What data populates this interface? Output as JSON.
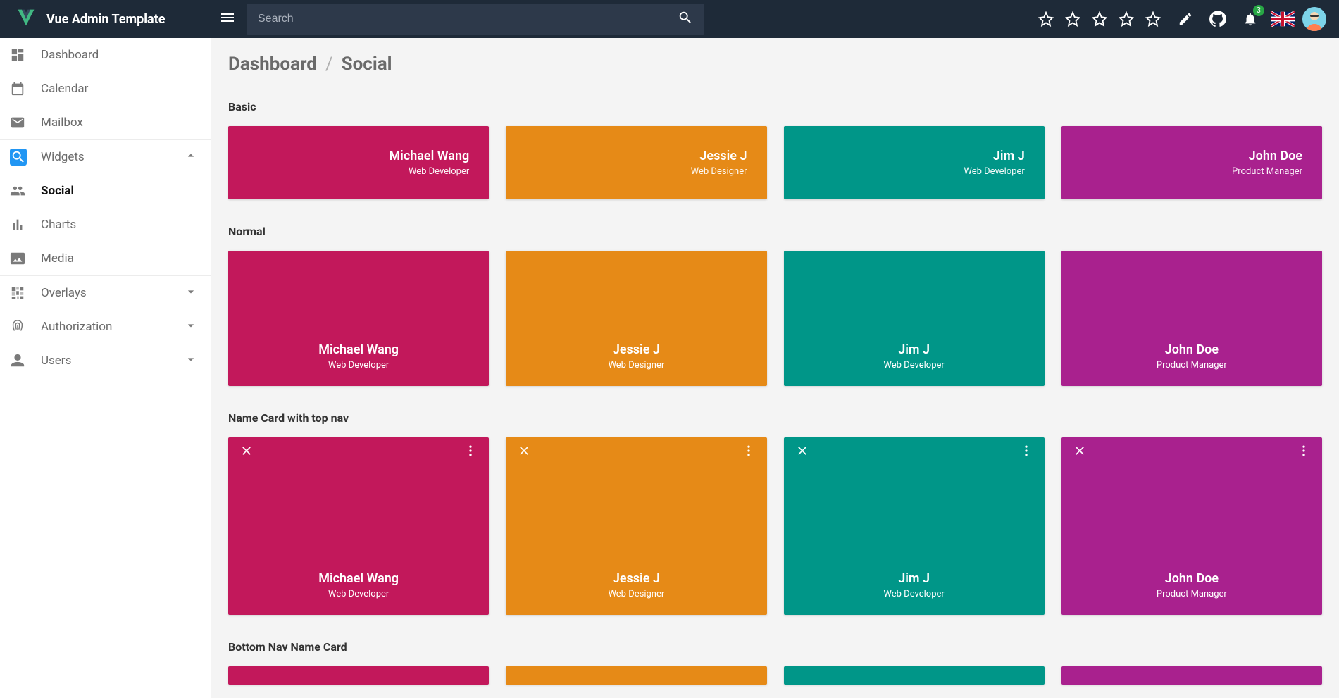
{
  "brand": {
    "title": "Vue Admin Template"
  },
  "search": {
    "placeholder": "Search"
  },
  "notifications": {
    "count": "3"
  },
  "sidebar": {
    "items": [
      {
        "label": "Dashboard"
      },
      {
        "label": "Calendar"
      },
      {
        "label": "Mailbox"
      },
      {
        "label": "Widgets"
      },
      {
        "label": "Social"
      },
      {
        "label": "Charts"
      },
      {
        "label": "Media"
      },
      {
        "label": "Overlays"
      },
      {
        "label": "Authorization"
      },
      {
        "label": "Users"
      }
    ]
  },
  "breadcrumb": {
    "root": "Dashboard",
    "current": "Social"
  },
  "sections": {
    "basic": "Basic",
    "normal": "Normal",
    "topnav": "Name Card with top nav",
    "bottomnav": "Bottom Nav Name Card"
  },
  "people": [
    {
      "name": "Michael Wang",
      "role": "Web Developer",
      "color": "c-crimson"
    },
    {
      "name": "Jessie J",
      "role": "Web Designer",
      "color": "c-orange"
    },
    {
      "name": "Jim J",
      "role": "Web Developer",
      "color": "c-teal"
    },
    {
      "name": "John Doe",
      "role": "Product Manager",
      "color": "c-purple"
    }
  ]
}
